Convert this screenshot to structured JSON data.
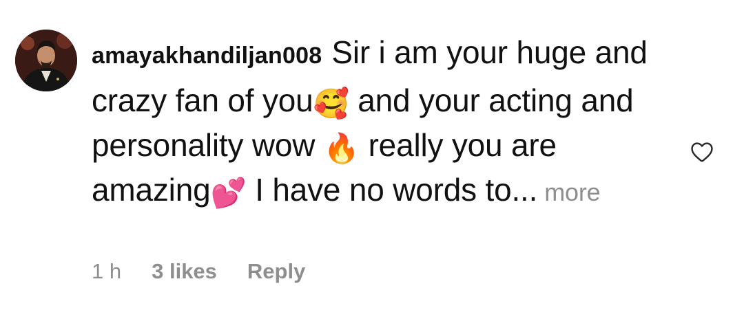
{
  "comment": {
    "username": "amayakhandiljan008",
    "text_segments": [
      "Sir i am your huge and crazy fan of you",
      "and your acting and personality wow",
      "really you are amazing",
      "I have no words to..."
    ],
    "emojis": [
      "🥰",
      "🔥",
      "💕"
    ],
    "more_label": "more"
  },
  "meta": {
    "time": "1 h",
    "likes": "3 likes",
    "reply_label": "Reply"
  },
  "icons": {
    "like": "heart-outline-icon",
    "avatar": "user-avatar"
  },
  "colors": {
    "text": "#111111",
    "muted": "#8e8e8e",
    "background": "#ffffff"
  }
}
